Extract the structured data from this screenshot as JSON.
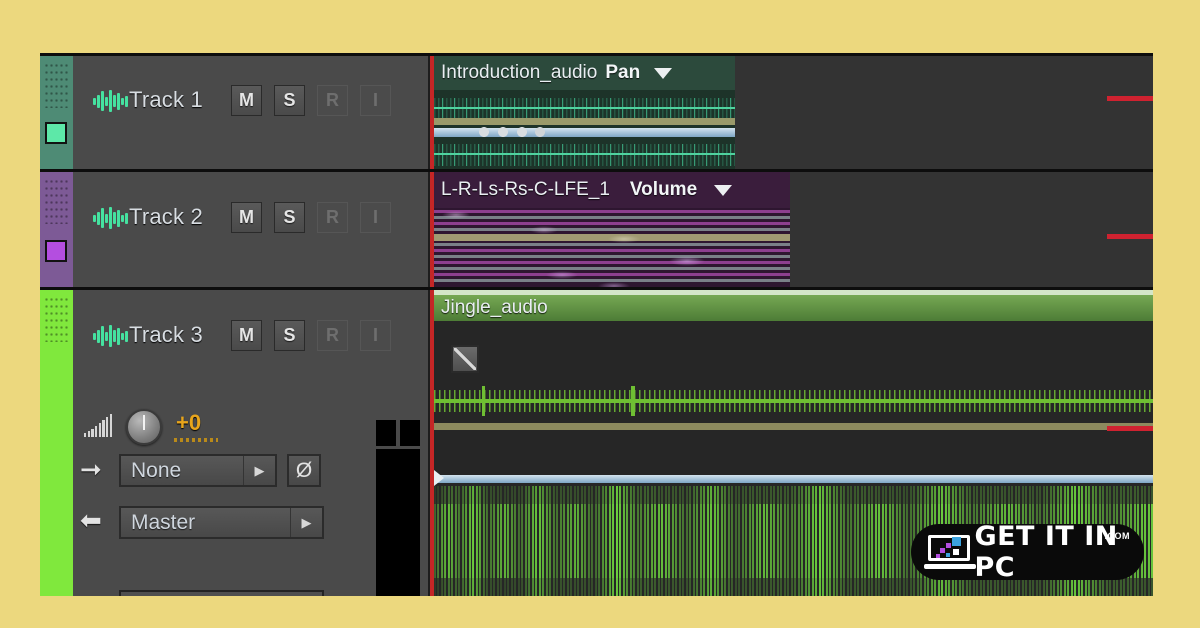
{
  "app": {
    "background_color": "#ecd87e",
    "window_bg": "#2c2c2c"
  },
  "tracks": [
    {
      "name": "Track 1",
      "color": "#4e8b75",
      "swatch_color": "#5de8a8",
      "buttons": [
        {
          "label": "M",
          "state": "on"
        },
        {
          "label": "S",
          "state": "on"
        },
        {
          "label": "R",
          "state": "off"
        },
        {
          "label": "I",
          "state": "off"
        }
      ],
      "clip": {
        "name": "Introduction_audio",
        "mode": "Pan",
        "header_color": "#2c4a3c",
        "body_color": "#1d3329"
      }
    },
    {
      "name": "Track 2",
      "color": "#7d5a96",
      "swatch_color": "#b44ee0",
      "buttons": [
        {
          "label": "M",
          "state": "on"
        },
        {
          "label": "S",
          "state": "on"
        },
        {
          "label": "R",
          "state": "off"
        },
        {
          "label": "I",
          "state": "off"
        }
      ],
      "clip": {
        "name": "L-R-Ls-Rs-C-LFE_1",
        "mode": "Volume",
        "header_color": "#3a1d3c",
        "body_color": "#2e1630"
      }
    },
    {
      "name": "Track 3",
      "color": "#80e83d",
      "swatch_color": "#80e83d",
      "buttons": [
        {
          "label": "M",
          "state": "on"
        },
        {
          "label": "S",
          "state": "on"
        },
        {
          "label": "R",
          "state": "off"
        },
        {
          "label": "I",
          "state": "off"
        }
      ],
      "gain_value": "+0",
      "input_routing": "None",
      "output_routing": "Master",
      "clip": {
        "name": "Jingle_audio",
        "mode": "",
        "header_color": "#5f9440",
        "body_color": "#262626",
        "waveform_color": "#6fd83f"
      }
    }
  ],
  "markers": {
    "playhead_color": "#c42626",
    "edge_marker_color": "#cf2230"
  },
  "watermark": {
    "text": "GET IT IN PC",
    "suffix": ".COM"
  }
}
